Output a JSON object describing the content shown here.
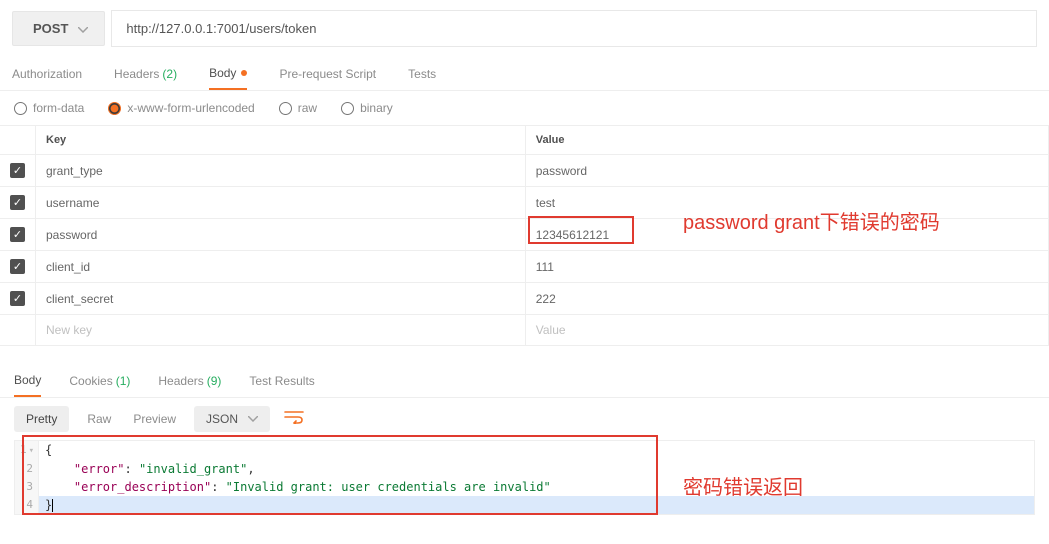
{
  "request": {
    "method": "POST",
    "url": "http://127.0.0.1:7001/users/token"
  },
  "reqTabs": {
    "authorization": "Authorization",
    "headers": "Headers",
    "headers_count": "(2)",
    "body": "Body",
    "prerequest": "Pre-request Script",
    "tests": "Tests"
  },
  "bodyTypes": {
    "formdata": "form-data",
    "urlencoded": "x-www-form-urlencoded",
    "raw": "raw",
    "binary": "binary"
  },
  "paramsHeader": {
    "key": "Key",
    "value": "Value"
  },
  "params": [
    {
      "key": "grant_type",
      "value": "password"
    },
    {
      "key": "username",
      "value": "test"
    },
    {
      "key": "password",
      "value": "12345612121"
    },
    {
      "key": "client_id",
      "value": "111"
    },
    {
      "key": "client_secret",
      "value": "222"
    }
  ],
  "paramsPlaceholder": {
    "key": "New key",
    "value": "Value"
  },
  "respTabs": {
    "body": "Body",
    "cookies": "Cookies",
    "cookies_count": "(1)",
    "headers": "Headers",
    "headers_count": "(9)",
    "tests": "Test Results"
  },
  "respToolbar": {
    "pretty": "Pretty",
    "raw": "Raw",
    "preview": "Preview",
    "format": "JSON"
  },
  "responseLines": {
    "l1": "{",
    "l2_indent": "    ",
    "l2_k": "\"error\"",
    "l2_sep": ": ",
    "l2_v": "\"invalid_grant\"",
    "l2_end": ",",
    "l3_indent": "    ",
    "l3_k": "\"error_description\"",
    "l3_sep": ": ",
    "l3_v": "\"Invalid grant: user credentials are invalid\"",
    "l4": "}"
  },
  "annotations": {
    "a1": "password grant下错误的密码",
    "a2": "密码错误返回"
  }
}
